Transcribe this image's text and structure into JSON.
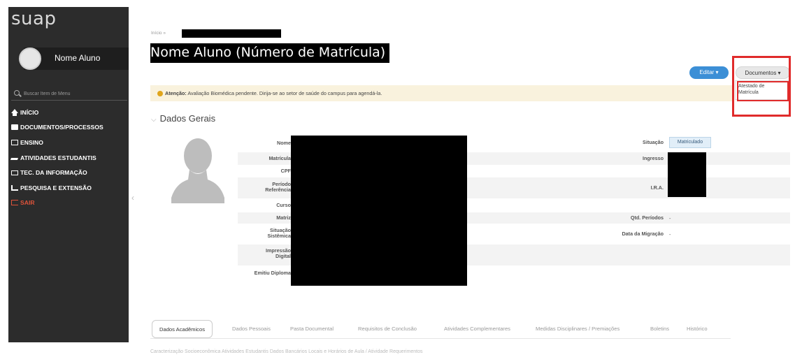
{
  "sidebar": {
    "logo": "suap",
    "user_name": "Nome Aluno",
    "search_placeholder": "Buscar Item de Menu",
    "items": [
      {
        "label": "INÍCIO",
        "icon": "home-icon"
      },
      {
        "label": "DOCUMENTOS/PROCESSOS",
        "icon": "documents-icon"
      },
      {
        "label": "ENSINO",
        "icon": "teaching-icon"
      },
      {
        "label": "ATIVIDADES ESTUDANTIS",
        "icon": "graduation-cap-icon"
      },
      {
        "label": "TEC. DA INFORMAÇÃO",
        "icon": "monitor-icon"
      },
      {
        "label": "PESQUISA E EXTENSÃO",
        "icon": "research-icon"
      },
      {
        "label": "SAIR",
        "icon": "exit-icon"
      }
    ],
    "collapse_icon": "‹"
  },
  "header": {
    "breadcrumb": "Início »",
    "title": "Nome Aluno (Número de Matrícula)"
  },
  "actions": {
    "editar": "Editar ▾",
    "documentos": "Documentos ▾",
    "dropdown_item": "Atestado de Matrícula"
  },
  "alert": {
    "strong": "Atenção:",
    "text": " Avaliação Biomédica pendente. Dirija-se ao setor de saúde do campus para agendá-la."
  },
  "section": {
    "chevron": "⌵",
    "title": "Dados Gerais"
  },
  "fields_left": [
    "Nome",
    "Matrícula",
    "CPF",
    "Período Referência",
    "Curso",
    "Matriz",
    "Situação Sistêmica",
    "Impressão Digital",
    "Emitiu Diploma"
  ],
  "fields_right": {
    "situacao_label": "Situação",
    "situacao_value": "Matriculado",
    "ingresso_label": "Ingresso",
    "ira_label": "I.R.A.",
    "periodos_label": "Qtd. Períodos",
    "periodos_value": "-",
    "migracao_label": "Data da Migração",
    "migracao_value": "-"
  },
  "tabs": [
    "Dados Acadêmicos",
    "Dados Pessoais",
    "Pasta Documental",
    "Requisitos de Conclusão",
    "Atividades Complementares",
    "Medidas Disciplinares / Premiações",
    "Boletins",
    "Histórico"
  ],
  "tabs_second_row": "Caracterização Socioeconômica      Atividades Estudantis      Dados Bancários      Locais e Horários de Aula / Atividade      Requerimentos"
}
